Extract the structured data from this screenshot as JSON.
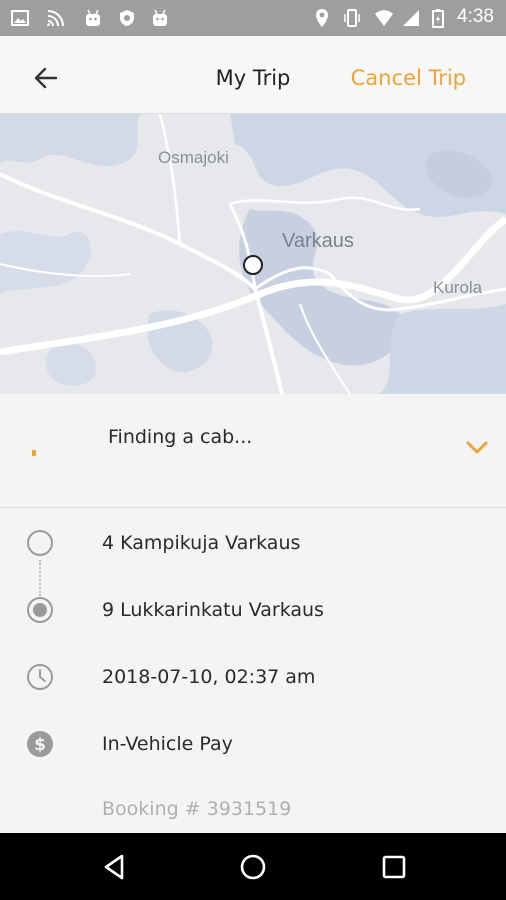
{
  "status_bar": {
    "time": "4:38",
    "icons": [
      "image-icon",
      "cast-icon",
      "android-icon",
      "shield-icon",
      "android-icon",
      "location-icon",
      "vibrate-icon",
      "wifi-icon",
      "signal-icon",
      "battery-icon"
    ]
  },
  "header": {
    "back_icon": "arrow-left-icon",
    "title": "My Trip",
    "cancel_label": "Cancel Trip"
  },
  "map": {
    "labels": {
      "osmajoki": "Osmajoki",
      "varkaus": "Varkaus",
      "kurola": "Kurola"
    }
  },
  "status_panel": {
    "text": "Finding a cab...",
    "expand_icon": "chevron-down-icon"
  },
  "trip": {
    "pickup": "4 Kampikuja Varkaus",
    "dropoff": "9 Lukkarinkatu Varkaus",
    "datetime": "2018-07-10, 02:37 am",
    "payment": "In-Vehicle Pay",
    "booking": "Booking # 3931519"
  },
  "colors": {
    "accent": "#f2a236",
    "status_bar": "#9e9e9e",
    "map_water": "#c9d3e3",
    "map_land": "#e6e8ec"
  }
}
